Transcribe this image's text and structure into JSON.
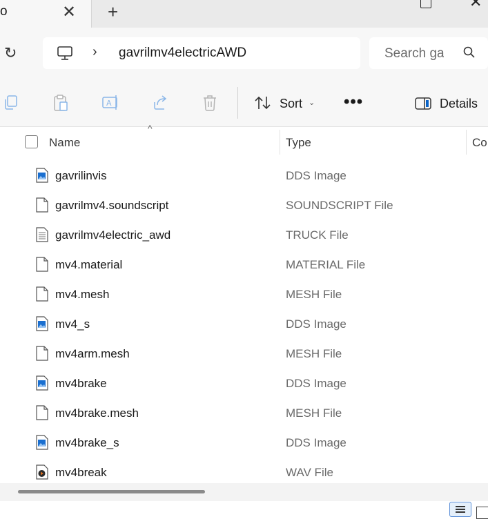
{
  "tab": {
    "title": "o",
    "close_icon": "close-icon",
    "new_tab_icon": "plus-icon"
  },
  "window_controls": {
    "minimize": "minimize-icon",
    "maximize": "maximize-icon",
    "close": "close-icon"
  },
  "address": {
    "location_icon": "this-pc-icon",
    "separator": "›",
    "folder": "gavrilmv4electricAWD"
  },
  "search": {
    "placeholder": "Search ga"
  },
  "toolbar": {
    "sort_label": "Sort",
    "more_label": "•••",
    "details_label": "Details",
    "icons": [
      "copy-icon",
      "paste-icon",
      "rename-icon",
      "share-icon",
      "delete-icon"
    ]
  },
  "columns": {
    "name": "Name",
    "type": "Type",
    "compressed": "Co"
  },
  "files": [
    {
      "name": "gavrilinvis",
      "type": "DDS Image",
      "icon": "image-file-icon"
    },
    {
      "name": "gavrilmv4.soundscript",
      "type": "SOUNDSCRIPT File",
      "icon": "blank-file-icon"
    },
    {
      "name": "gavrilmv4electric_awd",
      "type": "TRUCK File",
      "icon": "text-file-icon"
    },
    {
      "name": "mv4.material",
      "type": "MATERIAL File",
      "icon": "blank-file-icon"
    },
    {
      "name": "mv4.mesh",
      "type": "MESH File",
      "icon": "blank-file-icon"
    },
    {
      "name": "mv4_s",
      "type": "DDS Image",
      "icon": "image-file-icon"
    },
    {
      "name": "mv4arm.mesh",
      "type": "MESH File",
      "icon": "blank-file-icon"
    },
    {
      "name": "mv4brake",
      "type": "DDS Image",
      "icon": "image-file-icon"
    },
    {
      "name": "mv4brake.mesh",
      "type": "MESH File",
      "icon": "blank-file-icon"
    },
    {
      "name": "mv4brake_s",
      "type": "DDS Image",
      "icon": "image-file-icon"
    },
    {
      "name": "mv4break",
      "type": "WAV File",
      "icon": "audio-file-icon"
    }
  ],
  "colors": {
    "accent": "#0a64c8",
    "chrome": "#f7f7f7",
    "tabstrip": "#eaeaea"
  }
}
